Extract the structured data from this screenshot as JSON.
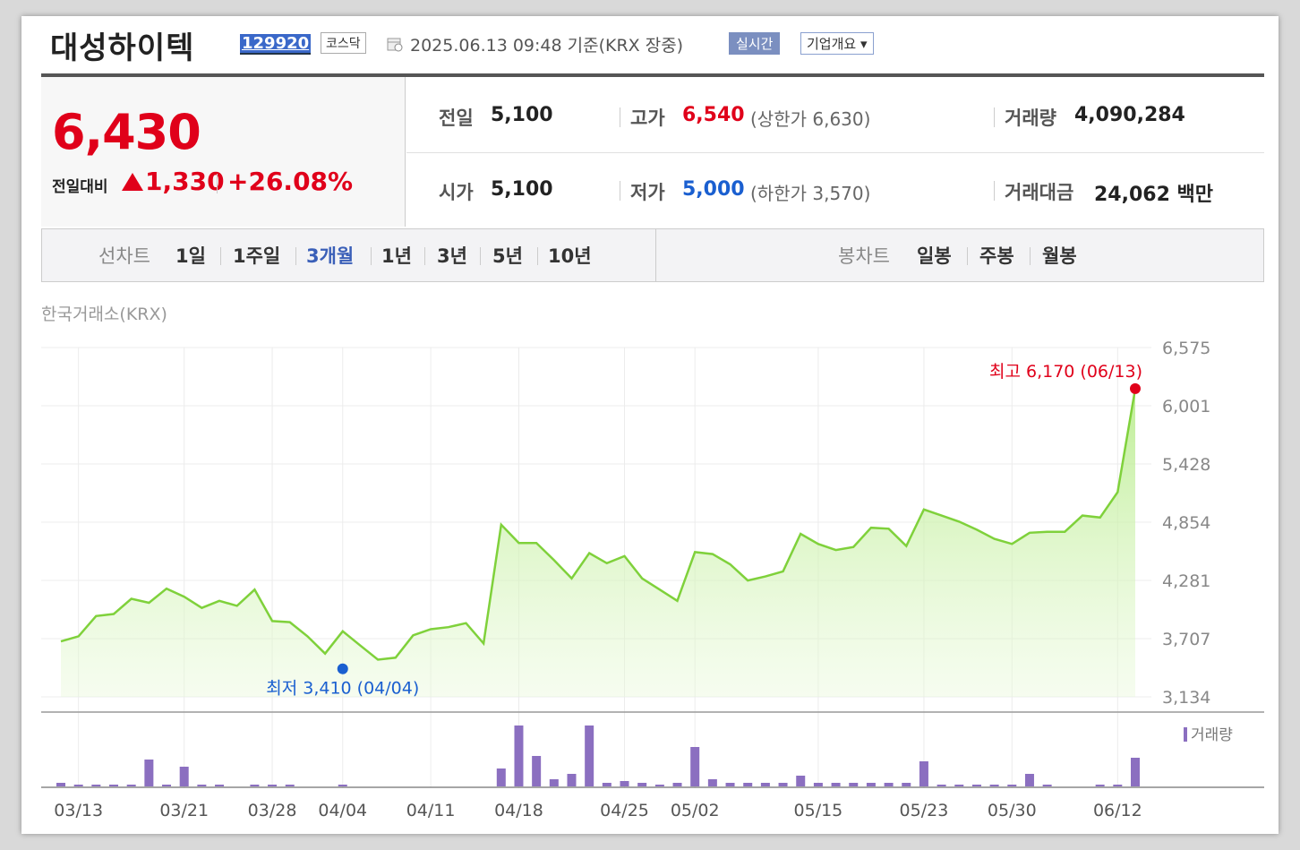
{
  "header": {
    "company_name": "대성하이텍",
    "stock_code": "129920",
    "market": "코스닥",
    "datetime_text": "2025.06.13 09:48  기준(KRX 장중)",
    "realtime_label": "실시간",
    "corp_overview_label": "기업개요 ▾"
  },
  "quote": {
    "price": "6,430",
    "change_label": "전일대비",
    "change_value": "1,330",
    "change_pct": "+26.08%",
    "prev_close_label": "전일",
    "prev_close": "5,100",
    "open_label": "시가",
    "open": "5,100",
    "high_label": "고가",
    "high": "6,540",
    "upper_limit_text": "(상한가 6,630)",
    "low_label": "저가",
    "low": "5,000",
    "lower_limit_text": "(하한가 3,570)",
    "volume_label": "거래량",
    "volume": "4,090,284",
    "amount_label": "거래대금",
    "amount": "24,062 백만"
  },
  "tabs": {
    "line_chart_label": "선차트",
    "line_periods": [
      "1일",
      "1주일",
      "3개월",
      "1년",
      "3년",
      "5년",
      "10년"
    ],
    "active_period": "3개월",
    "candle_label": "봉차트",
    "candle_periods": [
      "일봉",
      "주봉",
      "월봉"
    ]
  },
  "exchange_label": "한국거래소(KRX)",
  "colors": {
    "up": "#e0001a",
    "down": "#1a5fd0",
    "line": "#7fd13b",
    "volume": "#8b6fc0"
  },
  "chart_data": {
    "type": "area",
    "y_ticks": [
      "6,575",
      "6,001",
      "5,428",
      "4,854",
      "4,281",
      "3,707",
      "3,134"
    ],
    "ylim": [
      3134,
      6575
    ],
    "x_tick_labels": [
      "03/13",
      "03/21",
      "03/28",
      "04/04",
      "04/11",
      "04/18",
      "04/25",
      "05/02",
      "05/15",
      "05/23",
      "05/30",
      "06/12"
    ],
    "price_series": [
      3680,
      3730,
      3930,
      3950,
      4100,
      4060,
      4200,
      4120,
      4010,
      4080,
      4030,
      4190,
      3880,
      3870,
      3730,
      3560,
      3780,
      3640,
      3500,
      3520,
      3740,
      3800,
      3820,
      3860,
      3660,
      4830,
      4650,
      4650,
      4480,
      4300,
      4550,
      4450,
      4520,
      4300,
      4190,
      4080,
      4560,
      4540,
      4440,
      4280,
      4320,
      4370,
      4740,
      4640,
      4580,
      4610,
      4800,
      4790,
      4620,
      4980,
      4920,
      4860,
      4780,
      4690,
      4640,
      4750,
      4760,
      4760,
      4920,
      4900,
      5150,
      6170
    ],
    "volume_series": [
      4,
      2,
      2,
      2,
      2,
      30,
      2,
      22,
      2,
      2,
      0,
      2,
      2,
      2,
      0,
      0,
      2,
      0,
      0,
      0,
      0,
      0,
      0,
      0,
      0,
      20,
      68,
      34,
      8,
      14,
      68,
      4,
      6,
      4,
      2,
      4,
      44,
      8,
      4,
      4,
      4,
      4,
      12,
      4,
      4,
      4,
      4,
      4,
      4,
      28,
      2,
      2,
      2,
      2,
      2,
      14,
      2,
      0,
      0,
      2,
      2,
      32
    ],
    "high_annotation": "최고 6,170 (06/13)",
    "low_annotation": "최저 3,410 (04/04)",
    "low_value": 3410,
    "low_index": 16,
    "volume_legend": "거래량"
  }
}
